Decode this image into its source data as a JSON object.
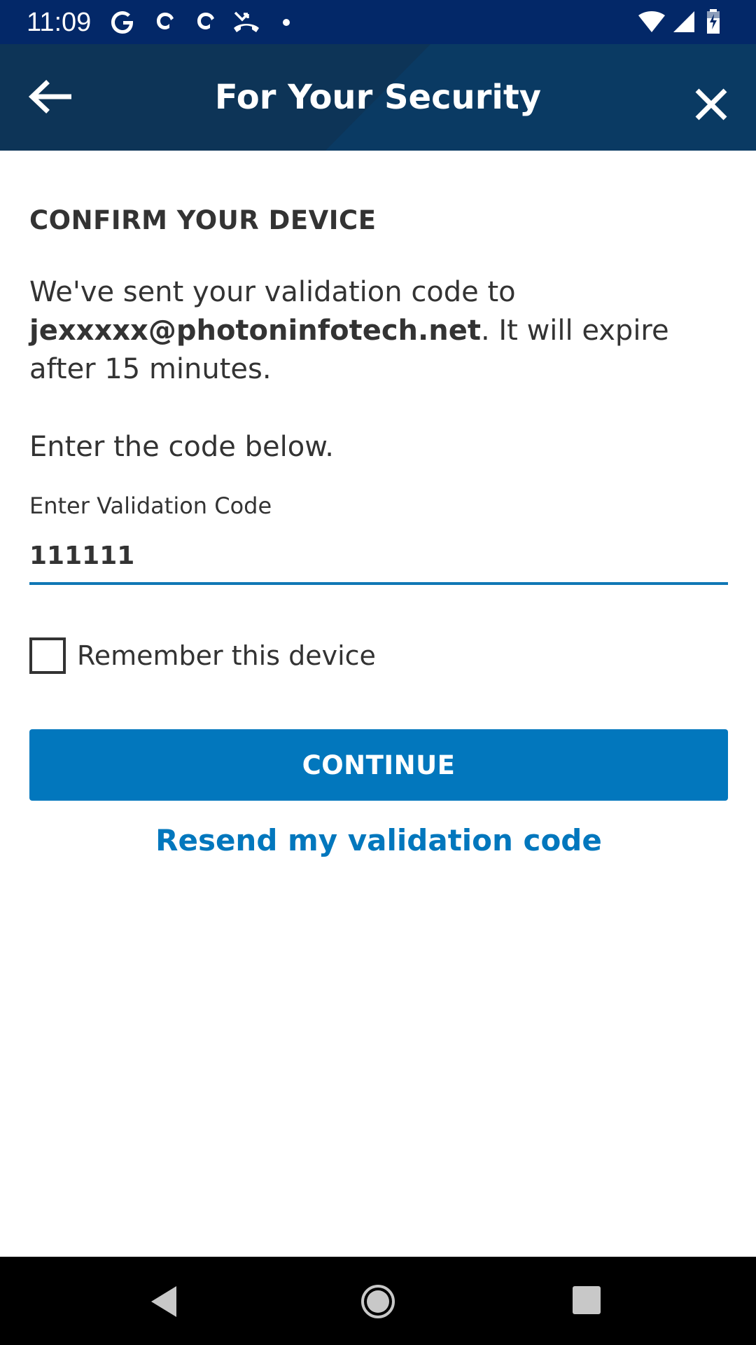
{
  "status_bar": {
    "time": "11:09",
    "left_icons": [
      "google-icon",
      "app-icon",
      "app-icon",
      "missed-call-icon",
      "dot-icon"
    ],
    "right_icons": [
      "wifi-icon",
      "signal-icon",
      "battery-icon"
    ]
  },
  "header": {
    "title": "For Your Security",
    "back_icon": "arrow-left-icon",
    "close_icon": "close-icon",
    "background": "#0a3a63"
  },
  "main": {
    "heading": "CONFIRM YOUR DEVICE",
    "message_prefix": "We've sent your validation code to ",
    "email": "jexxxxx@photoninfotech.net",
    "message_suffix": ". It will expire after 15 minutes.",
    "instruction": "Enter the code below.",
    "code_field": {
      "label": "Enter Validation Code",
      "value": "111111"
    },
    "remember_device": {
      "label": "Remember this device",
      "checked": false
    },
    "continue_label": "CONTINUE",
    "resend_label": "Resend my validation code",
    "accent_color": "#0277bd"
  },
  "nav_bar": {
    "buttons": [
      "back-triangle-icon",
      "home-circle-icon",
      "recents-square-icon"
    ]
  }
}
